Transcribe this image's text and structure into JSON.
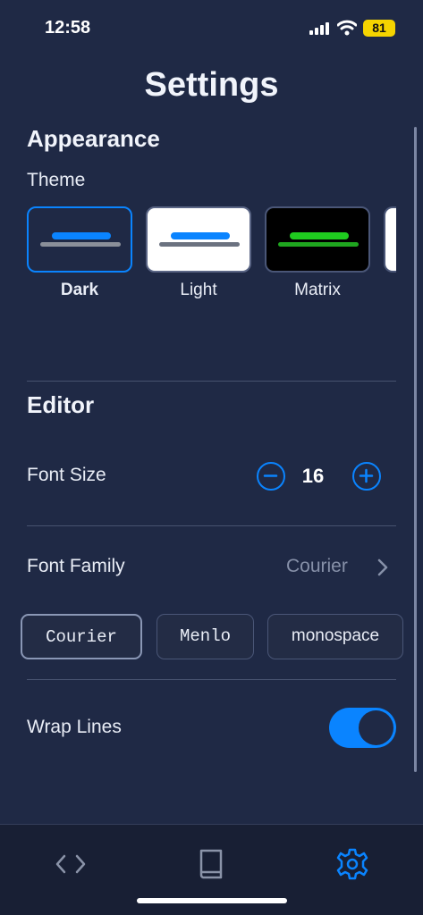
{
  "status_bar": {
    "time": "12:58",
    "battery": "81"
  },
  "title": "Settings",
  "appearance": {
    "heading": "Appearance",
    "theme_label": "Theme",
    "themes": [
      {
        "name": "Dark",
        "selected": true,
        "bg": "#1f2945",
        "accent": "#0a84ff",
        "line": "#8a8f99"
      },
      {
        "name": "Light",
        "selected": false,
        "bg": "#ffffff",
        "accent": "#0a84ff",
        "line": "#6b7280"
      },
      {
        "name": "Matrix",
        "selected": false,
        "bg": "#000000",
        "accent": "#1fcc1f",
        "line": "#1fa61f"
      }
    ]
  },
  "editor": {
    "heading": "Editor",
    "font_size_label": "Font Size",
    "font_size_value": "16",
    "font_family_label": "Font Family",
    "font_family_value": "Courier",
    "font_options": [
      {
        "label": "Courier",
        "selected": true
      },
      {
        "label": "Menlo",
        "selected": false
      },
      {
        "label": "monospace",
        "selected": false
      }
    ],
    "wrap_lines_label": "Wrap Lines",
    "wrap_lines_on": true
  },
  "tabs": [
    {
      "name": "code",
      "icon": "code-brackets-icon",
      "active": false
    },
    {
      "name": "docs",
      "icon": "book-icon",
      "active": false
    },
    {
      "name": "settings",
      "icon": "gear-icon",
      "active": true
    }
  ],
  "colors": {
    "accent": "#0a84ff",
    "background": "#1f2945",
    "tab_inactive": "#8a93a8"
  }
}
